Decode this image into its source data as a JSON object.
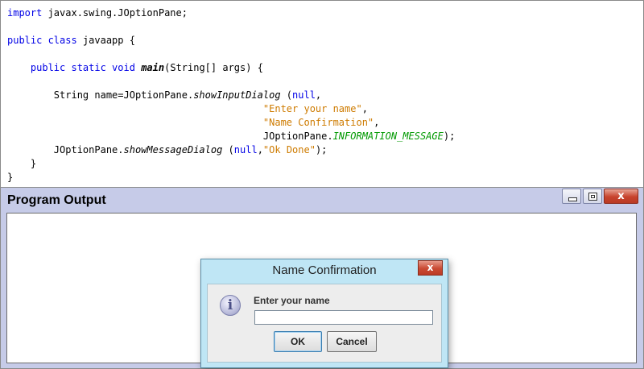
{
  "code": {
    "lines": [
      [
        {
          "t": "import",
          "c": "kw"
        },
        {
          "t": " javax.swing.JOptionPane;"
        }
      ],
      [],
      [
        {
          "t": "public class",
          "c": "kw"
        },
        {
          "t": " javaapp {"
        }
      ],
      [],
      [
        {
          "t": "    "
        },
        {
          "t": "public static void",
          "c": "kw"
        },
        {
          "t": " "
        },
        {
          "t": "main",
          "c": "m-bi"
        },
        {
          "t": "(String[] args) {"
        }
      ],
      [],
      [
        {
          "t": "        String name=JOptionPane."
        },
        {
          "t": "showInputDialog",
          "c": "m-it"
        },
        {
          "t": " ("
        },
        {
          "t": "null",
          "c": "kw"
        },
        {
          "t": ","
        }
      ],
      [
        {
          "t": "                                            "
        },
        {
          "t": "\"Enter your name\"",
          "c": "str"
        },
        {
          "t": ","
        }
      ],
      [
        {
          "t": "                                            "
        },
        {
          "t": "\"Name Confirmation\"",
          "c": "str"
        },
        {
          "t": ","
        }
      ],
      [
        {
          "t": "                                            JOptionPane."
        },
        {
          "t": "INFORMATION_MESSAGE",
          "c": "cst"
        },
        {
          "t": ");"
        }
      ],
      [
        {
          "t": "        JOptionPane."
        },
        {
          "t": "showMessageDialog",
          "c": "m-it"
        },
        {
          "t": " ("
        },
        {
          "t": "null",
          "c": "kw"
        },
        {
          "t": ","
        },
        {
          "t": "\"Ok Done\"",
          "c": "str"
        },
        {
          "t": ");"
        }
      ],
      [
        {
          "t": "    }"
        }
      ],
      [
        {
          "t": "}"
        }
      ]
    ]
  },
  "output_window": {
    "title": "Program Output",
    "controls": {
      "minimize_icon": "minimize-icon",
      "maximize_icon": "maximize-icon",
      "close_glyph": "x"
    }
  },
  "dialog": {
    "title": "Name Confirmation",
    "close_glyph": "x",
    "icon": "information-icon",
    "icon_glyph": "i",
    "prompt": "Enter your name",
    "input_value": "",
    "ok_label": "OK",
    "cancel_label": "Cancel"
  },
  "colors": {
    "keyword": "#0000e6",
    "string": "#ce7b00",
    "constant": "#009900",
    "window_frame": "#c6cbe8",
    "dialog_frame": "#bfe6f5",
    "close_button": "#c7432d"
  }
}
